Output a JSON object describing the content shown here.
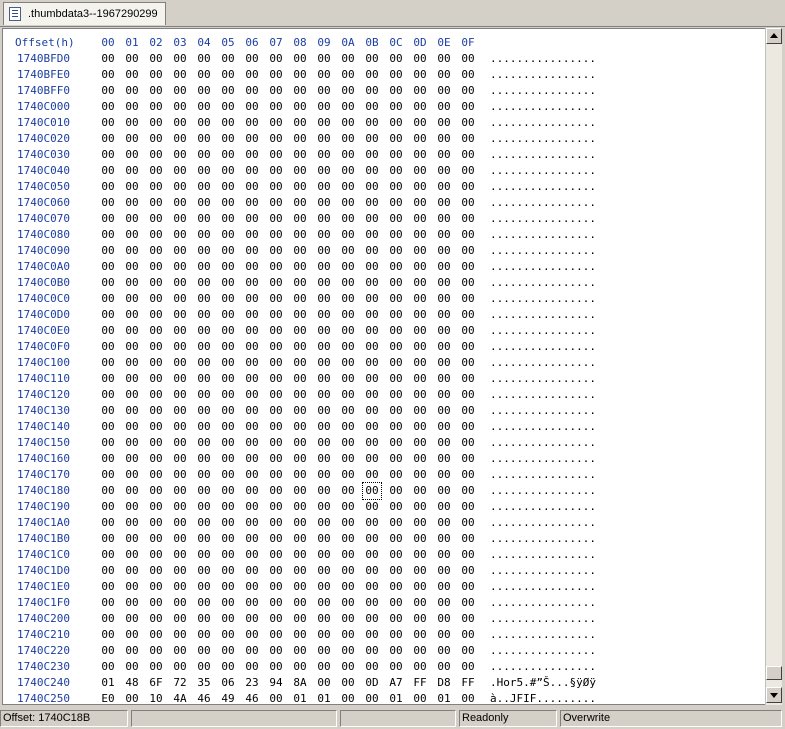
{
  "tab": {
    "label": ".thumbdata3--1967290299",
    "icon": "hex-file-icon"
  },
  "header": {
    "offset_label": "Offset(h)",
    "columns": [
      "00",
      "01",
      "02",
      "03",
      "04",
      "05",
      "06",
      "07",
      "08",
      "09",
      "0A",
      "0B",
      "0C",
      "0D",
      "0E",
      "0F"
    ]
  },
  "rows": [
    {
      "offset": "1740BFD0",
      "bytes": [
        "00",
        "00",
        "00",
        "00",
        "00",
        "00",
        "00",
        "00",
        "00",
        "00",
        "00",
        "00",
        "00",
        "00",
        "00",
        "00"
      ],
      "ascii": "................"
    },
    {
      "offset": "1740BFE0",
      "bytes": [
        "00",
        "00",
        "00",
        "00",
        "00",
        "00",
        "00",
        "00",
        "00",
        "00",
        "00",
        "00",
        "00",
        "00",
        "00",
        "00"
      ],
      "ascii": "................"
    },
    {
      "offset": "1740BFF0",
      "bytes": [
        "00",
        "00",
        "00",
        "00",
        "00",
        "00",
        "00",
        "00",
        "00",
        "00",
        "00",
        "00",
        "00",
        "00",
        "00",
        "00"
      ],
      "ascii": "................"
    },
    {
      "offset": "1740C000",
      "bytes": [
        "00",
        "00",
        "00",
        "00",
        "00",
        "00",
        "00",
        "00",
        "00",
        "00",
        "00",
        "00",
        "00",
        "00",
        "00",
        "00"
      ],
      "ascii": "................"
    },
    {
      "offset": "1740C010",
      "bytes": [
        "00",
        "00",
        "00",
        "00",
        "00",
        "00",
        "00",
        "00",
        "00",
        "00",
        "00",
        "00",
        "00",
        "00",
        "00",
        "00"
      ],
      "ascii": "................"
    },
    {
      "offset": "1740C020",
      "bytes": [
        "00",
        "00",
        "00",
        "00",
        "00",
        "00",
        "00",
        "00",
        "00",
        "00",
        "00",
        "00",
        "00",
        "00",
        "00",
        "00"
      ],
      "ascii": "................"
    },
    {
      "offset": "1740C030",
      "bytes": [
        "00",
        "00",
        "00",
        "00",
        "00",
        "00",
        "00",
        "00",
        "00",
        "00",
        "00",
        "00",
        "00",
        "00",
        "00",
        "00"
      ],
      "ascii": "................"
    },
    {
      "offset": "1740C040",
      "bytes": [
        "00",
        "00",
        "00",
        "00",
        "00",
        "00",
        "00",
        "00",
        "00",
        "00",
        "00",
        "00",
        "00",
        "00",
        "00",
        "00"
      ],
      "ascii": "................"
    },
    {
      "offset": "1740C050",
      "bytes": [
        "00",
        "00",
        "00",
        "00",
        "00",
        "00",
        "00",
        "00",
        "00",
        "00",
        "00",
        "00",
        "00",
        "00",
        "00",
        "00"
      ],
      "ascii": "................"
    },
    {
      "offset": "1740C060",
      "bytes": [
        "00",
        "00",
        "00",
        "00",
        "00",
        "00",
        "00",
        "00",
        "00",
        "00",
        "00",
        "00",
        "00",
        "00",
        "00",
        "00"
      ],
      "ascii": "................"
    },
    {
      "offset": "1740C070",
      "bytes": [
        "00",
        "00",
        "00",
        "00",
        "00",
        "00",
        "00",
        "00",
        "00",
        "00",
        "00",
        "00",
        "00",
        "00",
        "00",
        "00"
      ],
      "ascii": "................"
    },
    {
      "offset": "1740C080",
      "bytes": [
        "00",
        "00",
        "00",
        "00",
        "00",
        "00",
        "00",
        "00",
        "00",
        "00",
        "00",
        "00",
        "00",
        "00",
        "00",
        "00"
      ],
      "ascii": "................"
    },
    {
      "offset": "1740C090",
      "bytes": [
        "00",
        "00",
        "00",
        "00",
        "00",
        "00",
        "00",
        "00",
        "00",
        "00",
        "00",
        "00",
        "00",
        "00",
        "00",
        "00"
      ],
      "ascii": "................"
    },
    {
      "offset": "1740C0A0",
      "bytes": [
        "00",
        "00",
        "00",
        "00",
        "00",
        "00",
        "00",
        "00",
        "00",
        "00",
        "00",
        "00",
        "00",
        "00",
        "00",
        "00"
      ],
      "ascii": "................"
    },
    {
      "offset": "1740C0B0",
      "bytes": [
        "00",
        "00",
        "00",
        "00",
        "00",
        "00",
        "00",
        "00",
        "00",
        "00",
        "00",
        "00",
        "00",
        "00",
        "00",
        "00"
      ],
      "ascii": "................"
    },
    {
      "offset": "1740C0C0",
      "bytes": [
        "00",
        "00",
        "00",
        "00",
        "00",
        "00",
        "00",
        "00",
        "00",
        "00",
        "00",
        "00",
        "00",
        "00",
        "00",
        "00"
      ],
      "ascii": "................"
    },
    {
      "offset": "1740C0D0",
      "bytes": [
        "00",
        "00",
        "00",
        "00",
        "00",
        "00",
        "00",
        "00",
        "00",
        "00",
        "00",
        "00",
        "00",
        "00",
        "00",
        "00"
      ],
      "ascii": "................"
    },
    {
      "offset": "1740C0E0",
      "bytes": [
        "00",
        "00",
        "00",
        "00",
        "00",
        "00",
        "00",
        "00",
        "00",
        "00",
        "00",
        "00",
        "00",
        "00",
        "00",
        "00"
      ],
      "ascii": "................"
    },
    {
      "offset": "1740C0F0",
      "bytes": [
        "00",
        "00",
        "00",
        "00",
        "00",
        "00",
        "00",
        "00",
        "00",
        "00",
        "00",
        "00",
        "00",
        "00",
        "00",
        "00"
      ],
      "ascii": "................"
    },
    {
      "offset": "1740C100",
      "bytes": [
        "00",
        "00",
        "00",
        "00",
        "00",
        "00",
        "00",
        "00",
        "00",
        "00",
        "00",
        "00",
        "00",
        "00",
        "00",
        "00"
      ],
      "ascii": "................"
    },
    {
      "offset": "1740C110",
      "bytes": [
        "00",
        "00",
        "00",
        "00",
        "00",
        "00",
        "00",
        "00",
        "00",
        "00",
        "00",
        "00",
        "00",
        "00",
        "00",
        "00"
      ],
      "ascii": "................"
    },
    {
      "offset": "1740C120",
      "bytes": [
        "00",
        "00",
        "00",
        "00",
        "00",
        "00",
        "00",
        "00",
        "00",
        "00",
        "00",
        "00",
        "00",
        "00",
        "00",
        "00"
      ],
      "ascii": "................"
    },
    {
      "offset": "1740C130",
      "bytes": [
        "00",
        "00",
        "00",
        "00",
        "00",
        "00",
        "00",
        "00",
        "00",
        "00",
        "00",
        "00",
        "00",
        "00",
        "00",
        "00"
      ],
      "ascii": "................"
    },
    {
      "offset": "1740C140",
      "bytes": [
        "00",
        "00",
        "00",
        "00",
        "00",
        "00",
        "00",
        "00",
        "00",
        "00",
        "00",
        "00",
        "00",
        "00",
        "00",
        "00"
      ],
      "ascii": "................"
    },
    {
      "offset": "1740C150",
      "bytes": [
        "00",
        "00",
        "00",
        "00",
        "00",
        "00",
        "00",
        "00",
        "00",
        "00",
        "00",
        "00",
        "00",
        "00",
        "00",
        "00"
      ],
      "ascii": "................"
    },
    {
      "offset": "1740C160",
      "bytes": [
        "00",
        "00",
        "00",
        "00",
        "00",
        "00",
        "00",
        "00",
        "00",
        "00",
        "00",
        "00",
        "00",
        "00",
        "00",
        "00"
      ],
      "ascii": "................"
    },
    {
      "offset": "1740C170",
      "bytes": [
        "00",
        "00",
        "00",
        "00",
        "00",
        "00",
        "00",
        "00",
        "00",
        "00",
        "00",
        "00",
        "00",
        "00",
        "00",
        "00"
      ],
      "ascii": "................"
    },
    {
      "offset": "1740C180",
      "bytes": [
        "00",
        "00",
        "00",
        "00",
        "00",
        "00",
        "00",
        "00",
        "00",
        "00",
        "00",
        "00",
        "00",
        "00",
        "00",
        "00"
      ],
      "ascii": "................"
    },
    {
      "offset": "1740C190",
      "bytes": [
        "00",
        "00",
        "00",
        "00",
        "00",
        "00",
        "00",
        "00",
        "00",
        "00",
        "00",
        "00",
        "00",
        "00",
        "00",
        "00"
      ],
      "ascii": "................"
    },
    {
      "offset": "1740C1A0",
      "bytes": [
        "00",
        "00",
        "00",
        "00",
        "00",
        "00",
        "00",
        "00",
        "00",
        "00",
        "00",
        "00",
        "00",
        "00",
        "00",
        "00"
      ],
      "ascii": "................"
    },
    {
      "offset": "1740C1B0",
      "bytes": [
        "00",
        "00",
        "00",
        "00",
        "00",
        "00",
        "00",
        "00",
        "00",
        "00",
        "00",
        "00",
        "00",
        "00",
        "00",
        "00"
      ],
      "ascii": "................"
    },
    {
      "offset": "1740C1C0",
      "bytes": [
        "00",
        "00",
        "00",
        "00",
        "00",
        "00",
        "00",
        "00",
        "00",
        "00",
        "00",
        "00",
        "00",
        "00",
        "00",
        "00"
      ],
      "ascii": "................"
    },
    {
      "offset": "1740C1D0",
      "bytes": [
        "00",
        "00",
        "00",
        "00",
        "00",
        "00",
        "00",
        "00",
        "00",
        "00",
        "00",
        "00",
        "00",
        "00",
        "00",
        "00"
      ],
      "ascii": "................"
    },
    {
      "offset": "1740C1E0",
      "bytes": [
        "00",
        "00",
        "00",
        "00",
        "00",
        "00",
        "00",
        "00",
        "00",
        "00",
        "00",
        "00",
        "00",
        "00",
        "00",
        "00"
      ],
      "ascii": "................"
    },
    {
      "offset": "1740C1F0",
      "bytes": [
        "00",
        "00",
        "00",
        "00",
        "00",
        "00",
        "00",
        "00",
        "00",
        "00",
        "00",
        "00",
        "00",
        "00",
        "00",
        "00"
      ],
      "ascii": "................"
    },
    {
      "offset": "1740C200",
      "bytes": [
        "00",
        "00",
        "00",
        "00",
        "00",
        "00",
        "00",
        "00",
        "00",
        "00",
        "00",
        "00",
        "00",
        "00",
        "00",
        "00"
      ],
      "ascii": "................"
    },
    {
      "offset": "1740C210",
      "bytes": [
        "00",
        "00",
        "00",
        "00",
        "00",
        "00",
        "00",
        "00",
        "00",
        "00",
        "00",
        "00",
        "00",
        "00",
        "00",
        "00"
      ],
      "ascii": "................"
    },
    {
      "offset": "1740C220",
      "bytes": [
        "00",
        "00",
        "00",
        "00",
        "00",
        "00",
        "00",
        "00",
        "00",
        "00",
        "00",
        "00",
        "00",
        "00",
        "00",
        "00"
      ],
      "ascii": "................"
    },
    {
      "offset": "1740C230",
      "bytes": [
        "00",
        "00",
        "00",
        "00",
        "00",
        "00",
        "00",
        "00",
        "00",
        "00",
        "00",
        "00",
        "00",
        "00",
        "00",
        "00"
      ],
      "ascii": "................"
    },
    {
      "offset": "1740C240",
      "bytes": [
        "01",
        "48",
        "6F",
        "72",
        "35",
        "06",
        "23",
        "94",
        "8A",
        "00",
        "00",
        "0D",
        "A7",
        "FF",
        "D8",
        "FF"
      ],
      "ascii": ".Hor5.#”Š...§ÿØÿ"
    },
    {
      "offset": "1740C250",
      "bytes": [
        "E0",
        "00",
        "10",
        "4A",
        "46",
        "49",
        "46",
        "00",
        "01",
        "01",
        "00",
        "00",
        "01",
        "00",
        "01",
        "00"
      ],
      "ascii": "à..JFIF........."
    }
  ],
  "cursor": {
    "offset": "1740C18B"
  },
  "status": {
    "offset_text": "Offset: 1740C18B",
    "mode_readonly": "Readonly",
    "mode_overwrite": "Overwrite"
  }
}
